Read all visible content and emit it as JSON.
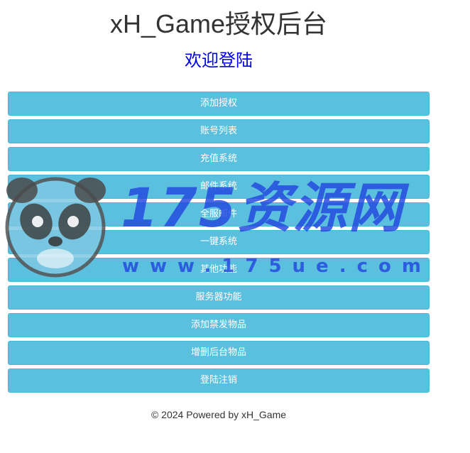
{
  "header": {
    "title": "xH_Game授权后台",
    "welcome": "欢迎登陆"
  },
  "menu": {
    "items": [
      {
        "label": "添加授权"
      },
      {
        "label": "账号列表"
      },
      {
        "label": "充值系统"
      },
      {
        "label": "邮件系统"
      },
      {
        "label": "全服邮件"
      },
      {
        "label": "一键系统"
      },
      {
        "label": "其他功能"
      },
      {
        "label": "服务器功能"
      },
      {
        "label": "添加禁发物品"
      },
      {
        "label": "增删后台物品"
      },
      {
        "label": "登陆注销"
      }
    ]
  },
  "footer": {
    "text": "© 2024 Powered by xH_Game"
  },
  "watermark": {
    "brand": "175资源网",
    "url": "www.175ue.com"
  },
  "colors": {
    "button_bg": "#5bc0de",
    "button_border": "#46b8da",
    "welcome_link": "#0000ee",
    "watermark": "#2348e0"
  }
}
